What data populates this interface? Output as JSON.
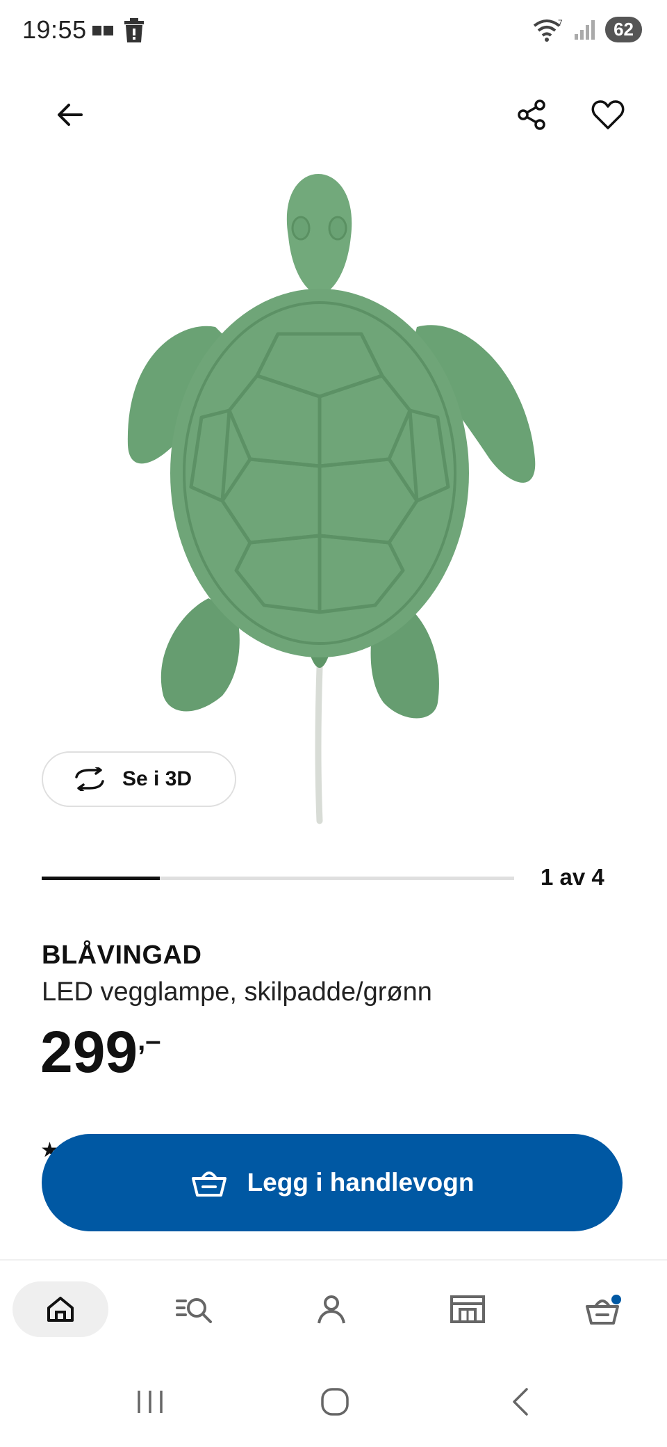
{
  "status_bar": {
    "time": "19:55",
    "network_label": "7",
    "battery": "62"
  },
  "icons": {
    "back": "arrow-left-icon",
    "share": "share-icon",
    "favorite": "heart-icon",
    "rotate3d": "rotate-icon",
    "cart_add": "basket-icon"
  },
  "product": {
    "image_alt": "green turtle wall lamp",
    "view_3d_label": "Se i 3D",
    "carousel": {
      "current": 1,
      "total": 4,
      "counter_label": "1 av 4",
      "progress": 0.25
    },
    "name": "BLÅVINGAD",
    "description": "LED vegglampe, skilpadde/grønn",
    "price": "299",
    "price_suffix": ",–"
  },
  "cta": {
    "add_to_cart_label": "Legg i handlevogn",
    "color": "#0058a3"
  },
  "bottom_nav": {
    "items": [
      "home",
      "search",
      "profile",
      "store",
      "cart"
    ],
    "active": "home",
    "cart_badge_color": "#0058a3"
  }
}
